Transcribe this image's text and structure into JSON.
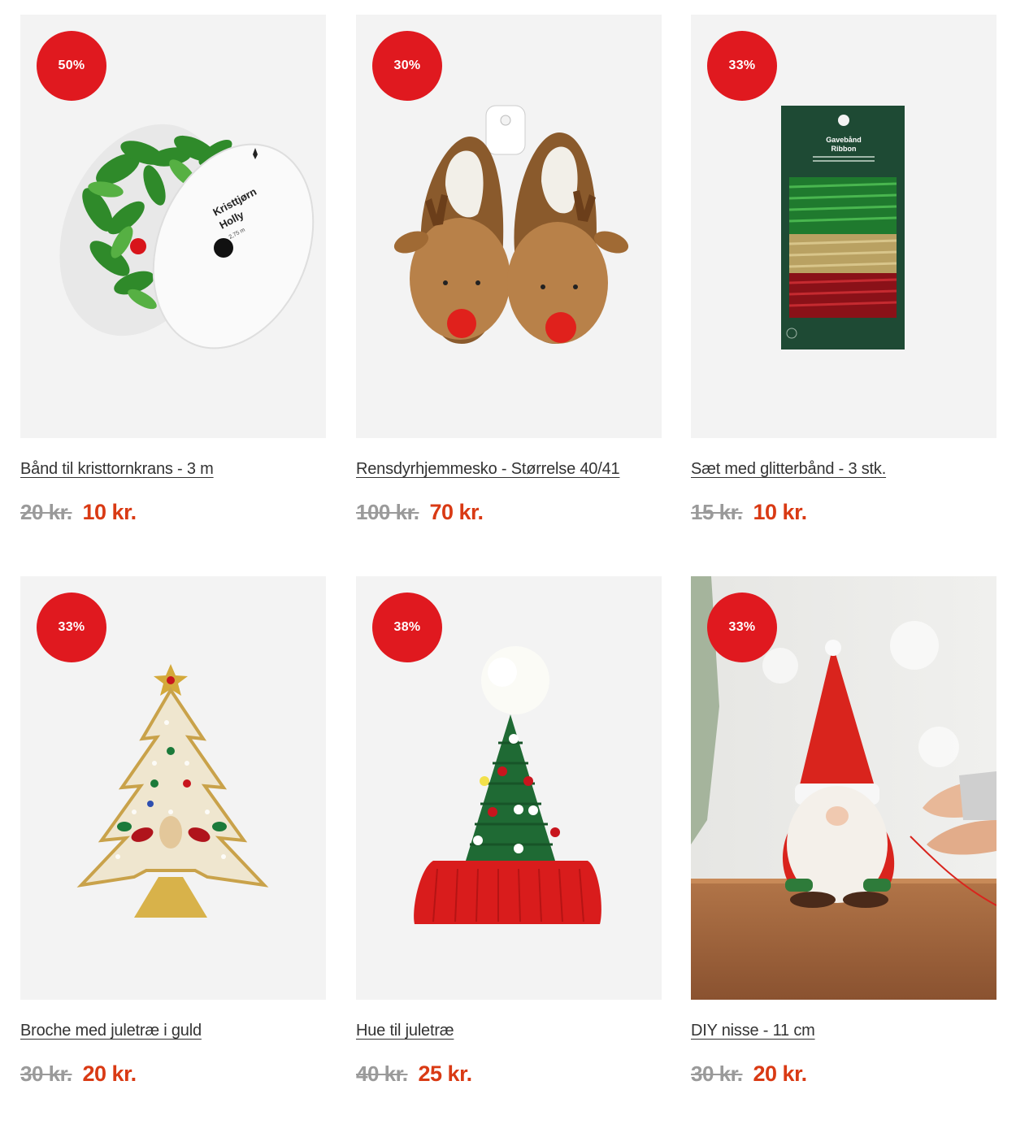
{
  "products": [
    {
      "discount": "50%",
      "title": "Bånd til kristtornkrans - 3 m",
      "old_price": "20 kr.",
      "new_price": "10 kr.",
      "image_icon": "holly-ribbon-spool-image",
      "package_label_1": "Kristtjørn",
      "package_label_2": "Holly",
      "package_label_3": "2,75 m"
    },
    {
      "discount": "30%",
      "title": "Rensdyrhjemmesko - Størrelse 40/41",
      "old_price": "100 kr.",
      "new_price": "70 kr.",
      "image_icon": "reindeer-slippers-image"
    },
    {
      "discount": "33%",
      "title": "Sæt med glitterbånd - 3 stk.",
      "old_price": "15 kr.",
      "new_price": "10 kr.",
      "image_icon": "glitter-ribbon-set-image",
      "package_label_1": "Gavebånd",
      "package_label_2": "Ribbon"
    },
    {
      "discount": "33%",
      "title": "Broche med juletræ i guld",
      "old_price": "30 kr.",
      "new_price": "20 kr.",
      "image_icon": "christmas-tree-brooch-image"
    },
    {
      "discount": "38%",
      "title": "Hue til juletræ",
      "old_price": "40 kr.",
      "new_price": "25 kr.",
      "image_icon": "christmas-tree-hat-image"
    },
    {
      "discount": "33%",
      "title": "DIY nisse - 11 cm",
      "old_price": "30 kr.",
      "new_price": "20 kr.",
      "image_icon": "diy-gnome-photo"
    }
  ],
  "colors": {
    "badge": "#e0191f",
    "new_price": "#d93a14",
    "old_price": "#9a9a9a",
    "card_bg": "#f3f3f3"
  }
}
